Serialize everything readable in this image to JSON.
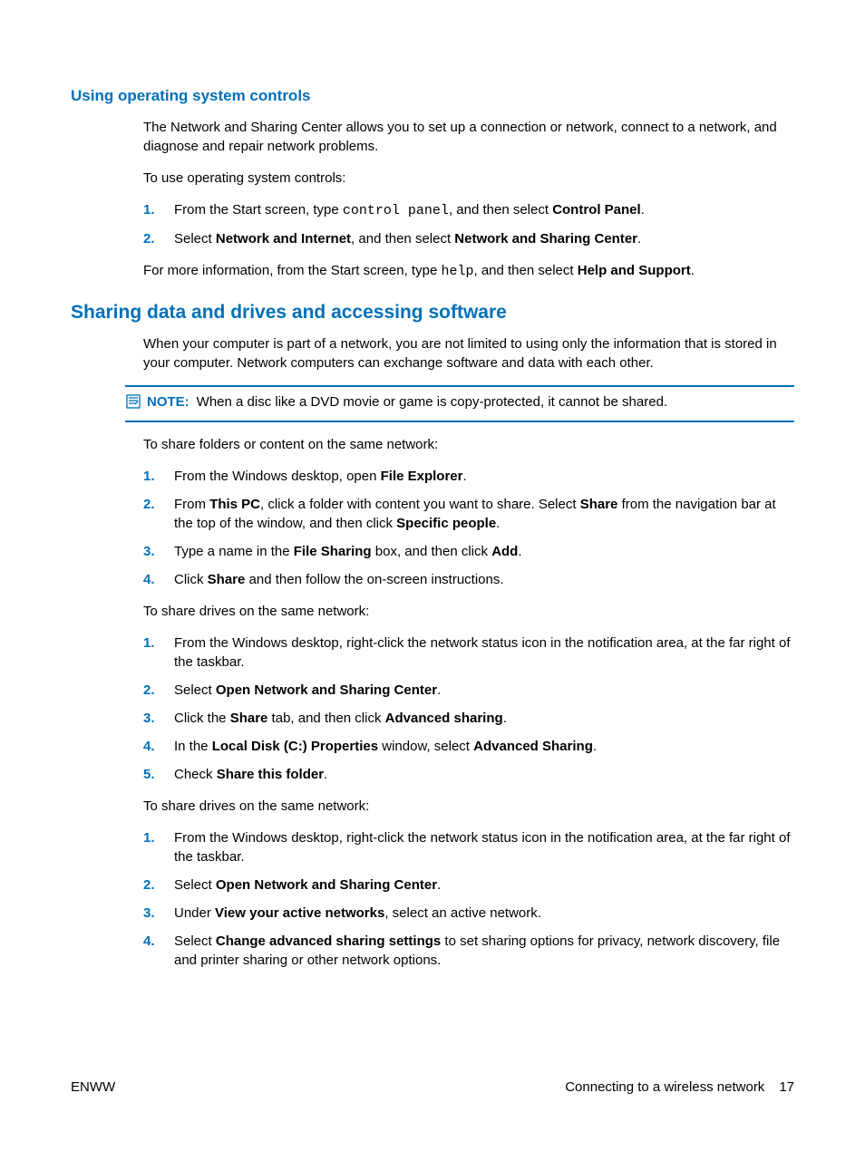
{
  "section1": {
    "heading": "Using operating system controls",
    "intro": "The Network and Sharing Center allows you to set up a connection or network, connect to a network, and diagnose and repair network problems.",
    "lead": "To use operating system controls:",
    "steps": [
      {
        "n": "1.",
        "pre": "From the Start screen, type ",
        "code": "control panel",
        "mid": ", and then select ",
        "bold": "Control Panel",
        "post": "."
      },
      {
        "n": "2.",
        "pre": "Select ",
        "bold1": "Network and Internet",
        "mid": ", and then select ",
        "bold2": "Network and Sharing Center",
        "post": "."
      }
    ],
    "closing_pre": "For more information, from the Start screen, type ",
    "closing_code": "help",
    "closing_mid": ", and then select ",
    "closing_bold": "Help and Support",
    "closing_post": "."
  },
  "section2": {
    "heading": "Sharing data and drives and accessing software",
    "intro": "When your computer is part of a network, you are not limited to using only the information that is stored in your computer. Network computers can exchange software and data with each other.",
    "note_label": "NOTE:",
    "note_text": "When a disc like a DVD movie or game is copy-protected, it cannot be shared.",
    "leadA": "To share folders or content on the same network:",
    "listA": [
      {
        "n": "1.",
        "pre": "From the Windows desktop, open ",
        "b1": "File Explorer",
        "post": "."
      },
      {
        "n": "2.",
        "pre": "From ",
        "b1": "This PC",
        "mid1": ", click a folder with content you want to share. Select ",
        "b2": "Share",
        "mid2": " from the navigation bar at the top of the window, and then click ",
        "b3": "Specific people",
        "post": "."
      },
      {
        "n": "3.",
        "pre": "Type a name in the ",
        "b1": "File Sharing",
        "mid1": " box, and then click ",
        "b2": "Add",
        "post": "."
      },
      {
        "n": "4.",
        "pre": "Click ",
        "b1": "Share",
        "mid1": " and then follow the on-screen instructions."
      }
    ],
    "leadB": "To share drives on the same network:",
    "listB": [
      {
        "n": "1.",
        "text": "From the Windows desktop, right-click the network status icon in the notification area, at the far right of the taskbar."
      },
      {
        "n": "2.",
        "pre": "Select ",
        "b1": "Open Network and Sharing Center",
        "post": "."
      },
      {
        "n": "3.",
        "pre": "Click the ",
        "b1": "Share",
        "mid1": " tab, and then click ",
        "b2": "Advanced sharing",
        "post": "."
      },
      {
        "n": "4.",
        "pre": "In the ",
        "b1": "Local Disk (C:) Properties",
        "mid1": " window, select ",
        "b2": "Advanced Sharing",
        "post": "."
      },
      {
        "n": "5.",
        "pre": "Check ",
        "b1": "Share this folder",
        "post": "."
      }
    ],
    "leadC": "To share drives on the same network:",
    "listC": [
      {
        "n": "1.",
        "text": "From the Windows desktop, right-click the network status icon in the notification area, at the far right of the taskbar."
      },
      {
        "n": "2.",
        "pre": "Select ",
        "b1": "Open Network and Sharing Center",
        "post": "."
      },
      {
        "n": "3.",
        "pre": "Under ",
        "b1": "View your active networks",
        "mid1": ", select an active network."
      },
      {
        "n": "4.",
        "pre": "Select ",
        "b1": "Change advanced sharing settings",
        "mid1": " to set sharing options for privacy, network discovery, file and printer sharing or other network options."
      }
    ]
  },
  "footer": {
    "left": "ENWW",
    "right_text": "Connecting to a wireless network",
    "page": "17"
  }
}
